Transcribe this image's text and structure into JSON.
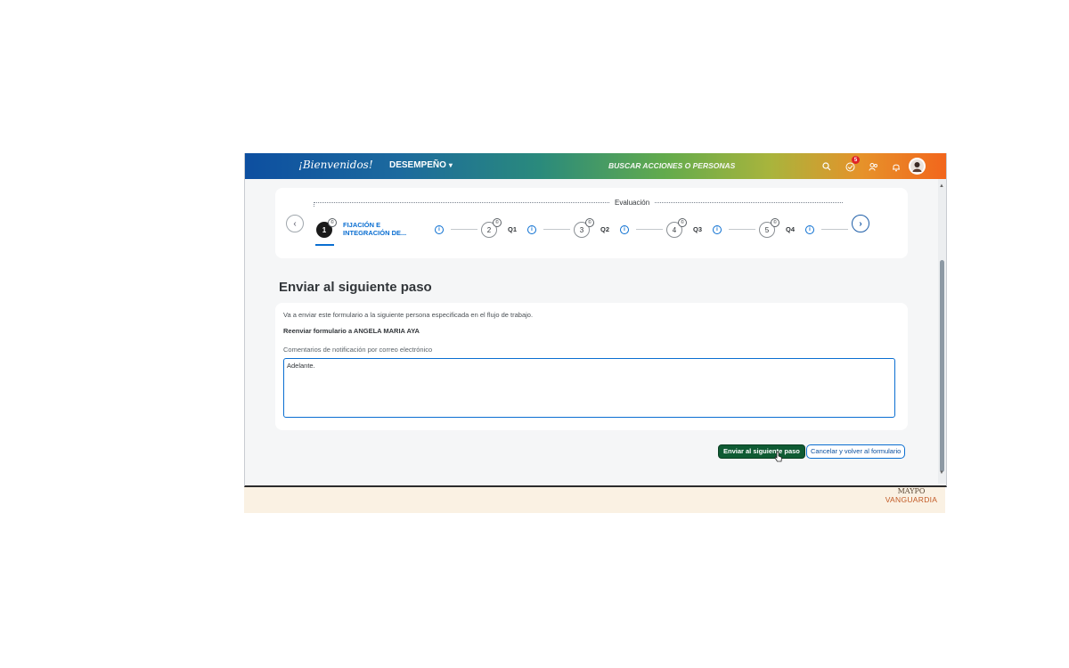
{
  "header": {
    "brand": "¡Bienvenidos!",
    "menu_label": "DESEMPEÑO",
    "search_placeholder": "BUSCAR ACCIONES O PERSONAS",
    "todo_badge": "5",
    "icons": [
      "search-icon",
      "check-circle-icon",
      "people-icon",
      "bell-icon",
      "avatar"
    ]
  },
  "stepper": {
    "group_label": "Evaluación",
    "steps": [
      {
        "number": "1",
        "marker": "©",
        "label_line1": "FIJACIÓN E",
        "label_line2": "INTEGRACIÓN DE..."
      },
      {
        "number": "2",
        "marker": "©",
        "label": "Q1"
      },
      {
        "number": "3",
        "marker": "©",
        "label": "Q2"
      },
      {
        "number": "4",
        "marker": "©",
        "label": "Q3"
      },
      {
        "number": "5",
        "marker": "©",
        "label": "Q4"
      }
    ]
  },
  "main": {
    "title": "Enviar al siguiente paso",
    "description": "Va a enviar este formulario a la siguiente persona especificada en el flujo de trabajo.",
    "forward_to": "Reenviar formulario a ANGELA MARIA AYA",
    "comments_label": "Comentarios de notificación por correo electrónico",
    "comments_value": "Adelante."
  },
  "actions": {
    "submit_label": "Enviar al siguiente paso",
    "cancel_label": "Cancelar y volver al formulario"
  },
  "footer": {
    "logo_line1": "MAYPO",
    "logo_line2": "",
    "logo_line3": "VANGUARDIA"
  },
  "colors": {
    "accent": "#0a6ed1",
    "primary_button": "#0f5b33",
    "footer_bg": "#faf1e3"
  }
}
